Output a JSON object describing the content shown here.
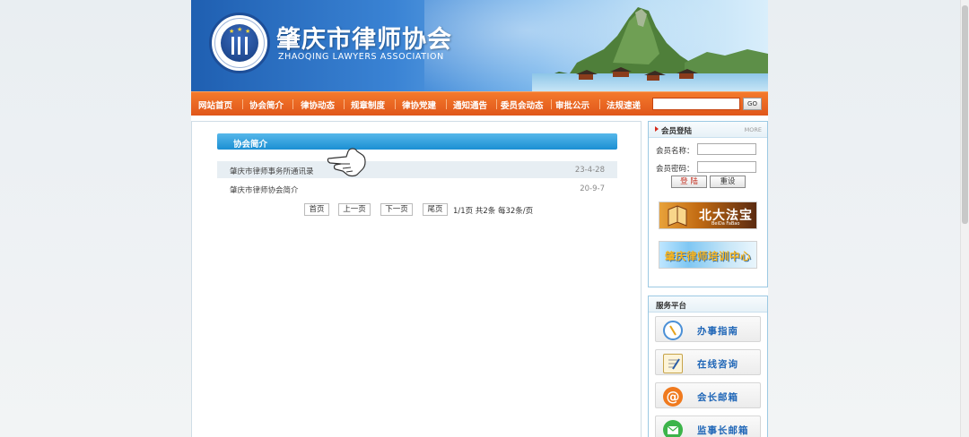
{
  "site": {
    "title": "肇庆市律师协会",
    "subtitle": "ZHAOQING LAWYERS ASSOCIATION"
  },
  "nav": {
    "items": [
      "网站首页",
      "协会简介",
      "律协动态",
      "规章制度",
      "律协党建",
      "通知通告",
      "委员会动态",
      "审批公示",
      "法规速递"
    ],
    "search_placeholder": "",
    "go_label": "GO"
  },
  "main": {
    "section_title": "协会简介",
    "rows": [
      {
        "title": "肇庆市律师事务所通讯录",
        "date": "23-4-28"
      },
      {
        "title": "肇庆市律师协会简介",
        "date": "20-9-7"
      }
    ],
    "pager": {
      "first": "首页",
      "prev": "上一页",
      "next": "下一页",
      "last": "尾页",
      "info": "1/1页 共2条 每32条/页"
    }
  },
  "sidebar": {
    "login": {
      "title": "会员登陆",
      "more": "MORE",
      "username_label": "会员名称：",
      "password_label": "会员密码：",
      "login_button": "登 陆",
      "reset_button": "重设"
    },
    "ads": [
      {
        "text": "北大法宝",
        "sub": "BeiDa FaBao"
      },
      {
        "text": "肇庆律师培训中心"
      }
    ],
    "service": {
      "title": "服务平台",
      "items": [
        {
          "label": "办事指南",
          "icon": "compass-icon",
          "color": "#4a8fd6"
        },
        {
          "label": "在线咨询",
          "icon": "document-pen-icon",
          "color": "#f2c24a"
        },
        {
          "label": "会长邮箱",
          "icon": "at-mail-icon",
          "color": "#f07a1e"
        },
        {
          "label": "监事长邮箱",
          "icon": "envelope-icon",
          "color": "#3cb44a"
        }
      ]
    }
  },
  "colors": {
    "nav": "#e8661f",
    "section_bar": "#2b9ddb",
    "link": "#1f66b7"
  }
}
